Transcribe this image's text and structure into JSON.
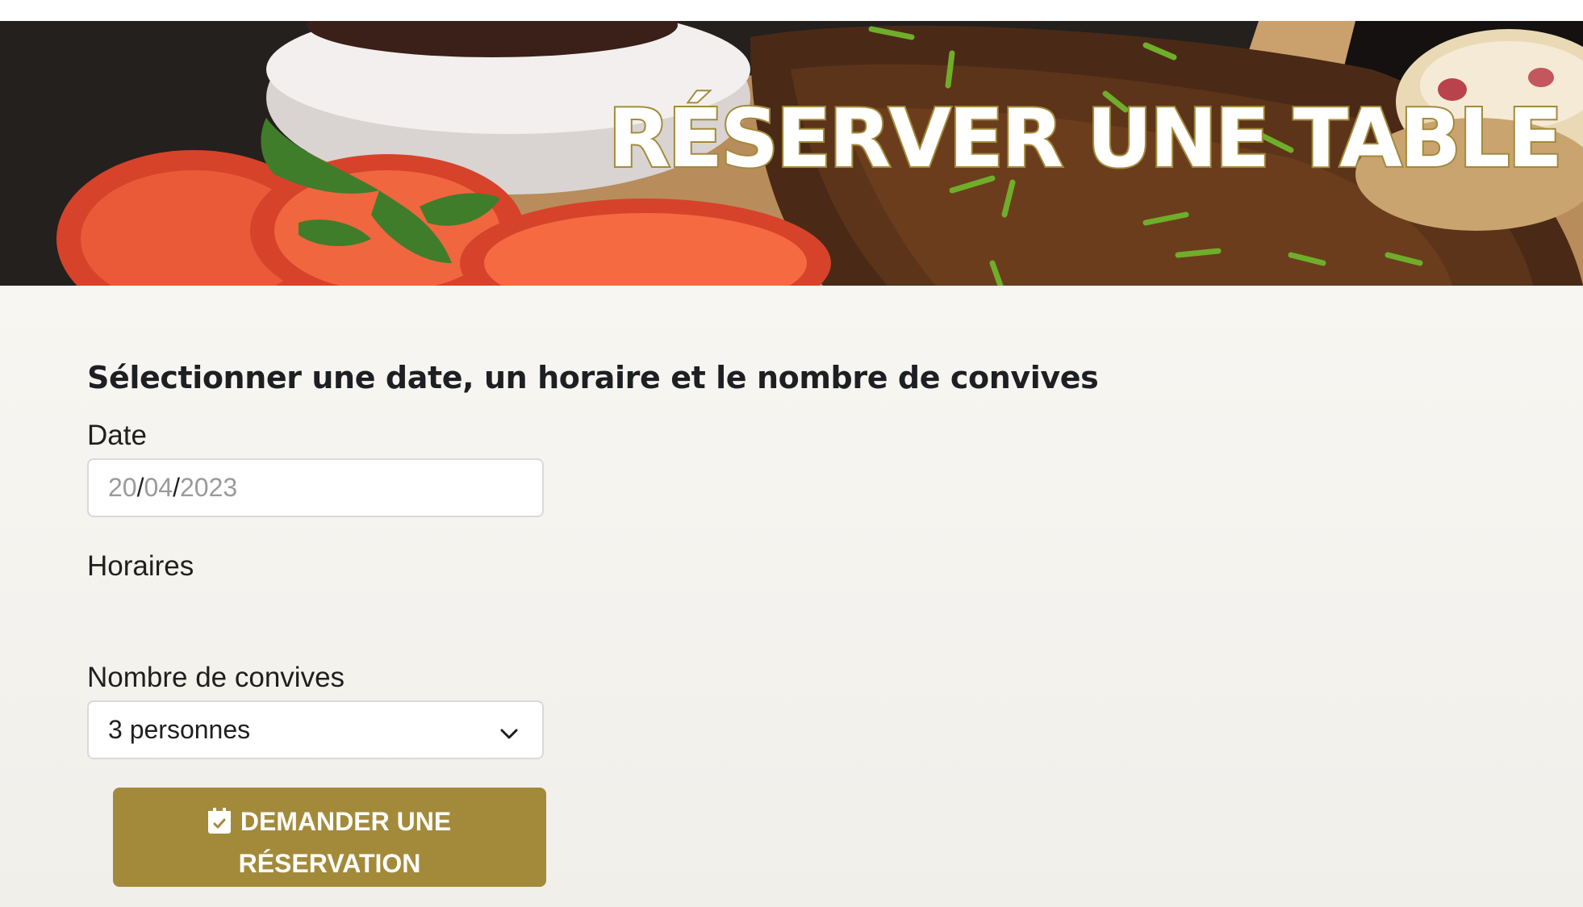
{
  "hero": {
    "title": "RÉSERVER UNE TABLE"
  },
  "form": {
    "heading": "Sélectionner une date, un horaire et le nombre de convives",
    "date": {
      "label": "Date",
      "day": "20",
      "month": "04",
      "year": "2023",
      "separator": "/"
    },
    "hours": {
      "label": "Horaires"
    },
    "guests": {
      "label": "Nombre de convives",
      "selected": "3 personnes"
    },
    "submit": {
      "line1": "DEMANDER UNE",
      "line2": "RÉSERVATION",
      "icon": "calendar-check-icon"
    }
  },
  "colors": {
    "accent": "#a38a3a",
    "background": "#f4f2ed",
    "text": "#1e1f22"
  }
}
